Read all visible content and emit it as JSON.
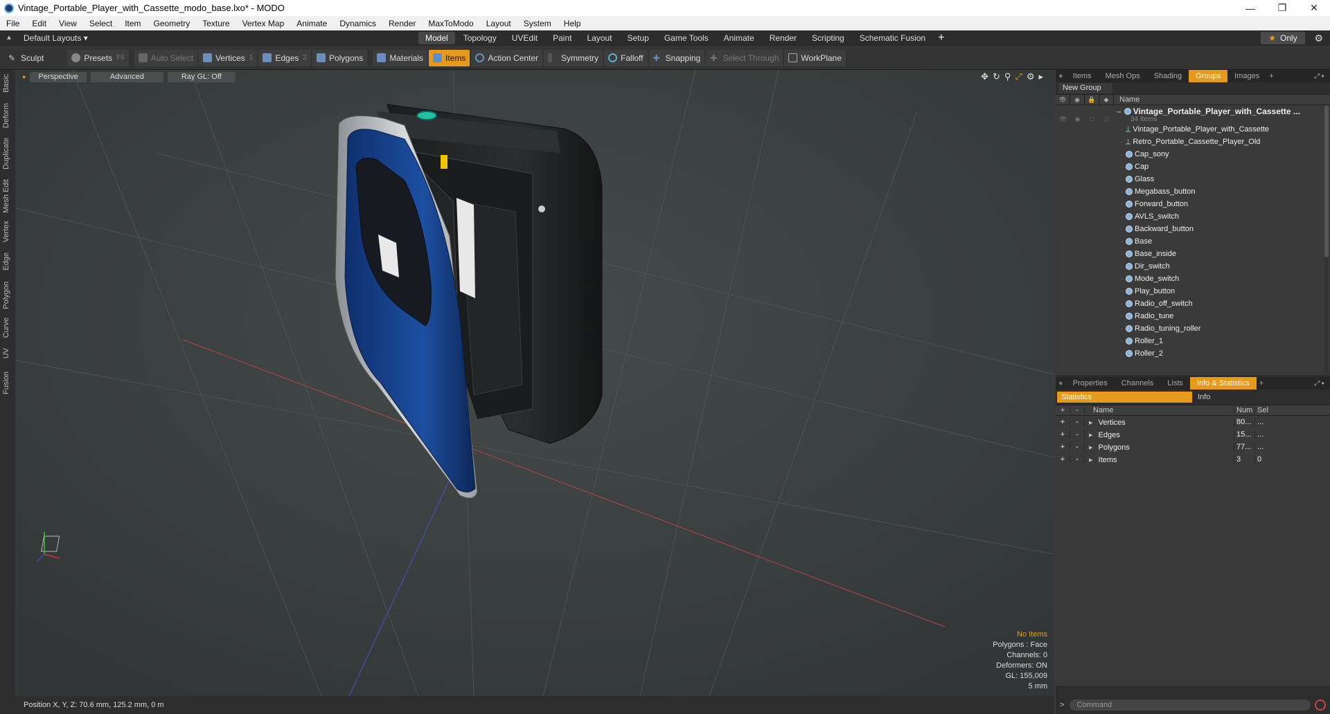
{
  "window": {
    "title": "Vintage_Portable_Player_with_Cassette_modo_base.lxo* - MODO"
  },
  "menu": [
    "File",
    "Edit",
    "View",
    "Select",
    "Item",
    "Geometry",
    "Texture",
    "Vertex Map",
    "Animate",
    "Dynamics",
    "Render",
    "MaxToModo",
    "Layout",
    "System",
    "Help"
  ],
  "layout": {
    "dropdown": "Default Layouts ▾",
    "tabs": [
      "Model",
      "Topology",
      "UVEdit",
      "Paint",
      "Layout",
      "Setup",
      "Game Tools",
      "Animate",
      "Render",
      "Scripting",
      "Schematic Fusion"
    ],
    "active_tab": "Model",
    "only": "Only"
  },
  "toolbar": {
    "sculpt": "Sculpt",
    "presets": "Presets",
    "presets_key": "F6",
    "auto_select": "Auto Select",
    "vertices": "Vertices",
    "vertices_key": "1",
    "edges": "Edges",
    "edges_key": "2",
    "polygons": "Polygons",
    "materials": "Materials",
    "items": "Items",
    "action_center": "Action Center",
    "symmetry": "Symmetry",
    "falloff": "Falloff",
    "snapping": "Snapping",
    "select_through": "Select Through",
    "workplane": "WorkPlane"
  },
  "left_tabs": [
    "Basic",
    "Deform",
    "Duplicate",
    "Mesh Edit",
    "Vertex",
    "Edge",
    "Polygon",
    "Curve",
    "UV",
    "Fusion"
  ],
  "viewport": {
    "perspective": "Perspective",
    "advanced": "Advanced",
    "raygl": "Ray GL: Off",
    "stats": {
      "no_items": "No Items",
      "polygons": "Polygons : Face",
      "channels": "Channels: 0",
      "deformers": "Deformers: ON",
      "gl": "GL: 155,009",
      "scale": "5 mm"
    }
  },
  "groups_panel": {
    "tabs": [
      "Items",
      "Mesh Ops",
      "Shading",
      "Groups",
      "Images"
    ],
    "active_tab": "Groups",
    "new_group": "New Group",
    "name_header": "Name",
    "root": {
      "name": "Vintage_Portable_Player_with_Cassette ...",
      "count": "34 Items"
    },
    "items": [
      {
        "label": "Vintage_Portable_Player_with_Cassette",
        "kind": "locator"
      },
      {
        "label": "Retro_Portable_Cassette_Player_Old",
        "kind": "locator"
      },
      {
        "label": "Cap_sony",
        "kind": "mesh"
      },
      {
        "label": "Cap",
        "kind": "mesh"
      },
      {
        "label": "Glass",
        "kind": "mesh"
      },
      {
        "label": "Megabass_button",
        "kind": "mesh"
      },
      {
        "label": "Forward_button",
        "kind": "mesh"
      },
      {
        "label": "AVLS_switch",
        "kind": "mesh"
      },
      {
        "label": "Backward_button",
        "kind": "mesh"
      },
      {
        "label": "Base",
        "kind": "mesh"
      },
      {
        "label": "Base_inside",
        "kind": "mesh"
      },
      {
        "label": "Dir_switch",
        "kind": "mesh"
      },
      {
        "label": "Mode_switch",
        "kind": "mesh"
      },
      {
        "label": "Play_button",
        "kind": "mesh"
      },
      {
        "label": "Radio_off_switch",
        "kind": "mesh"
      },
      {
        "label": "Radio_tune",
        "kind": "mesh"
      },
      {
        "label": "Radio_tuning_roller",
        "kind": "mesh"
      },
      {
        "label": "Roller_1",
        "kind": "mesh"
      },
      {
        "label": "Roller_2",
        "kind": "mesh"
      }
    ]
  },
  "info_panel": {
    "tabs": [
      "Properties",
      "Channels",
      "Lists",
      "Info & Statistics"
    ],
    "active_tab": "Info & Statistics",
    "statistics": "Statistics",
    "info": "Info",
    "columns": {
      "name": "Name",
      "num": "Num",
      "sel": "Sel"
    },
    "rows": [
      {
        "name": "Vertices",
        "num": "80...",
        "sel": "..."
      },
      {
        "name": "Edges",
        "num": "15...",
        "sel": "..."
      },
      {
        "name": "Polygons",
        "num": "77...",
        "sel": "..."
      },
      {
        "name": "Items",
        "num": "3",
        "sel": "0"
      }
    ]
  },
  "command": {
    "prompt": ">",
    "placeholder": "Command"
  },
  "status": {
    "position": "Position X, Y, Z:  70.6 mm, 125.2 mm, 0 m"
  },
  "colors": {
    "accent": "#e59a1c",
    "viewport_bg": "#3d4242",
    "player_blue": "#1a4a9a"
  }
}
